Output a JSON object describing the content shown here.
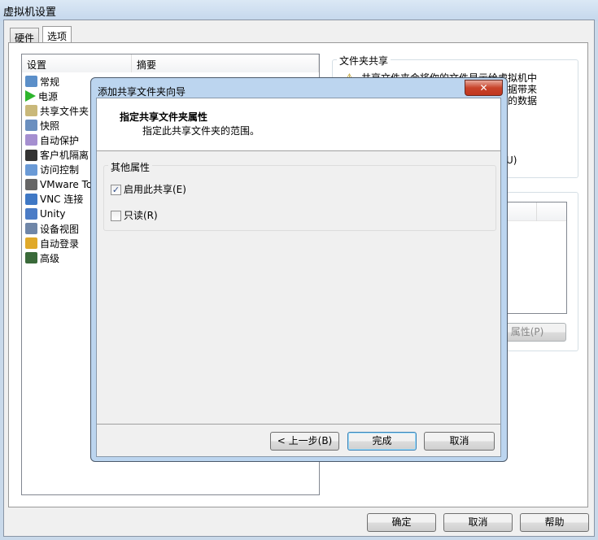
{
  "window": {
    "title": "虚拟机设置"
  },
  "tabs": [
    {
      "label": "硬件"
    },
    {
      "label": "选项"
    }
  ],
  "list": {
    "headers": [
      "设置",
      "摘要"
    ],
    "items": [
      {
        "label": "常规",
        "icon": "monitor-icon"
      },
      {
        "label": "电源",
        "icon": "play-icon"
      },
      {
        "label": "共享文件夹",
        "icon": "folder-icon"
      },
      {
        "label": "快照",
        "icon": "snapshot-clock-icon"
      },
      {
        "label": "自动保护",
        "icon": "autoprotect-icon"
      },
      {
        "label": "客户机隔离",
        "icon": "lock-icon"
      },
      {
        "label": "访问控制",
        "icon": "access-lock-icon"
      },
      {
        "label": "VMware To",
        "icon": "vm-icon"
      },
      {
        "label": "VNC 连接",
        "icon": "vnc-monitor-icon"
      },
      {
        "label": "Unity",
        "icon": "unity-icon"
      },
      {
        "label": "设备视图",
        "icon": "device-view-icon"
      },
      {
        "label": "自动登录",
        "icon": "user-key-icon"
      },
      {
        "label": "高级",
        "icon": "advanced-chart-icon"
      }
    ]
  },
  "right": {
    "group_title": "文件夹共享",
    "warning_lines": [
      "共享文件夹会将你的文件显示给虚拟机中",
      "据带来",
      "的数据"
    ],
    "option_fragment": "U)",
    "properties_button": "属性(P)"
  },
  "buttons": {
    "ok": "确定",
    "cancel": "取消",
    "help": "帮助"
  },
  "dialog": {
    "title": "添加共享文件夹向导",
    "heading": "指定共享文件夹属性",
    "subheading": "指定此共享文件夹的范围。",
    "group_title": "其他属性",
    "enable_share": {
      "label": "启用此共享(E)",
      "checked": true
    },
    "read_only": {
      "label": "只读(R)",
      "checked": false
    },
    "back": "< 上一步(B)",
    "finish": "完成",
    "cancel": "取消"
  }
}
